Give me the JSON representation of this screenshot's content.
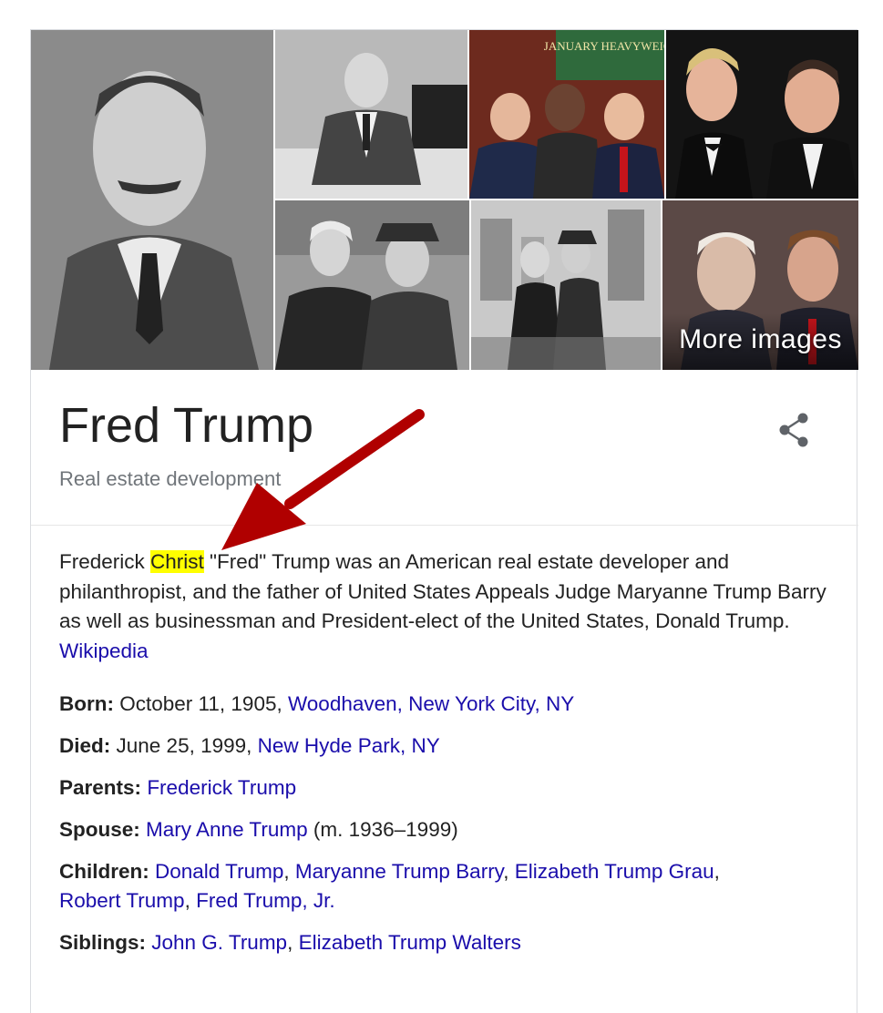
{
  "gallery": {
    "more_images_label": "More images",
    "photo_3_sign_text": "JANUARY HEAVYWEIG"
  },
  "entity": {
    "title": "Fred Trump",
    "subtitle": "Real estate development"
  },
  "description": {
    "before": "Frederick ",
    "highlight": "Christ",
    "after": " \"Fred\" Trump was an American real estate developer and philanthropist, and the father of United States Appeals Judge Maryanne Trump Barry as well as businessman and President-elect of the United States, Donald Trump. ",
    "source_link": "Wikipedia",
    "highlight_color": "#ffff00"
  },
  "facts": {
    "born": {
      "label": "Born:",
      "text": "October 11, 1905, ",
      "link": "Woodhaven, New York City, NY"
    },
    "died": {
      "label": "Died:",
      "text": "June 25, 1999, ",
      "link": "New Hyde Park, NY"
    },
    "parents": {
      "label": "Parents:",
      "link": "Frederick Trump"
    },
    "spouse": {
      "label": "Spouse:",
      "link": "Mary Anne Trump",
      "after": " (m. 1936–1999)"
    },
    "children": {
      "label": "Children:",
      "links": [
        "Donald Trump",
        "Maryanne Trump Barry",
        "Elizabeth Trump Grau",
        "Robert Trump",
        "Fred Trump, Jr."
      ]
    },
    "siblings": {
      "label": "Siblings:",
      "links": [
        "John G. Trump",
        "Elizabeth Trump Walters"
      ]
    }
  },
  "icons": {
    "share": "share-icon"
  },
  "colors": {
    "link": "#1a0dab",
    "annotation_arrow": "#b00000"
  }
}
